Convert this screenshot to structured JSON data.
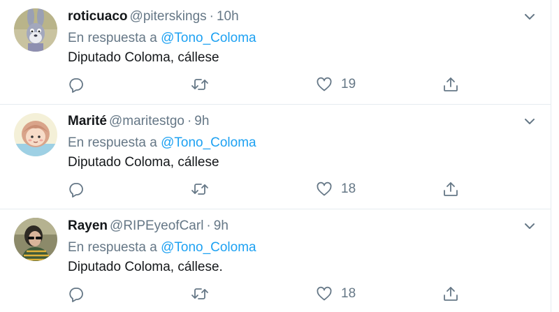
{
  "tweets": [
    {
      "name": "roticuaco",
      "handle": "@piterskings",
      "time": "10h",
      "reply_prefix": "En respuesta a",
      "reply_to": "@Tono_Coloma",
      "text": "Diputado Coloma, cállese",
      "likes": "19"
    },
    {
      "name": "Marité",
      "handle": "@maritestgo",
      "time": "9h",
      "reply_prefix": "En respuesta a",
      "reply_to": "@Tono_Coloma",
      "text": "Diputado Coloma, cállese",
      "likes": "18"
    },
    {
      "name": "Rayen",
      "handle": "@RIPEyeofCarl",
      "time": "9h",
      "reply_prefix": "En respuesta a",
      "reply_to": "@Tono_Coloma",
      "text": "Diputado Coloma, cállese.",
      "likes": "18"
    }
  ],
  "separator": "·",
  "icons": {
    "reply": "reply-icon",
    "retweet": "retweet-icon",
    "like": "heart-icon",
    "share": "share-icon",
    "more": "chevron-down-icon"
  },
  "colors": {
    "link": "#1da1f2",
    "secondary_text": "#657786",
    "primary_text": "#14171a",
    "divider": "#e6ecf0"
  }
}
